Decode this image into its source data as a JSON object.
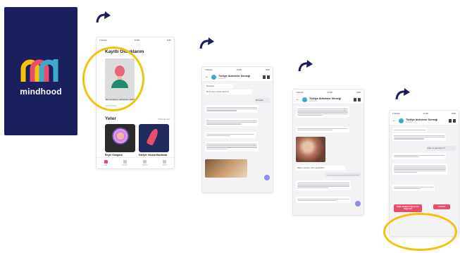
{
  "splash": {
    "brand": "mindhood",
    "background": "#1b1f5e"
  },
  "screen1": {
    "status_carrier": "Turkcell",
    "status_time": "13:36",
    "status_battery": "%46",
    "section_recorded": "Kayıtlı Olduklarım",
    "recorded_item_title": "Ner olmalıyız: Alzheimer midir?",
    "recorded_item_sub": "Sohbet devam",
    "section_popular": "Yeter",
    "see_all": "Tümünü Gör",
    "tiles": [
      {
        "title": "Beyin Güngücü",
        "sub": "1 saat"
      },
      {
        "title": "Kariyer Yoluna Başlamak",
        "sub": "1 saat"
      }
    ],
    "tabs": [
      "Ana",
      "Keşfet",
      "Sohbet",
      "Profil"
    ]
  },
  "chat_header": {
    "name": "Türkiye Alzheimer Derneği",
    "status": "çevrimiçi"
  },
  "screen2": {
    "msgs": [
      "Merhaba!",
      "Bu konuyu merak ediyoruz.",
      "Merhaba"
    ]
  },
  "screen3": {
    "msgs": [
      "Bakım verirken neler yapabiliriz?"
    ]
  },
  "screen4": {
    "msgs": [
      "Peki ne yapmalıyım?"
    ],
    "choices": [
      "Diğer detayları öğrenmek istiyorum",
      "Anladım"
    ]
  },
  "colors": {
    "accent": "#e84e6a",
    "highlight": "#f4c20d",
    "navy": "#1b1f5e"
  }
}
